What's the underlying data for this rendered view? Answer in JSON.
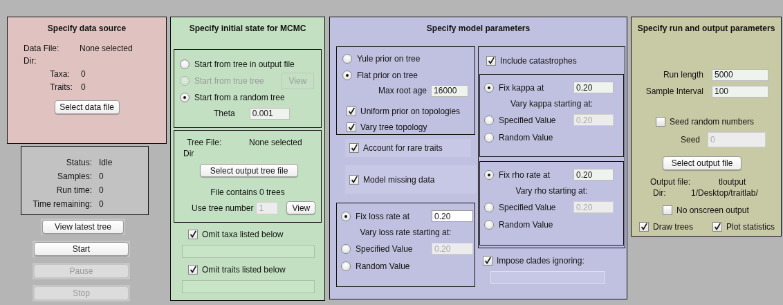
{
  "data_source": {
    "title": "Specify data source",
    "file_label": "Data File:",
    "file_value": "None selected",
    "dir_label": "Dir:",
    "counts": [
      {
        "label": "Taxa:",
        "value": "0"
      },
      {
        "label": "Traits:",
        "value": "0"
      }
    ],
    "button": "Select data file"
  },
  "status": [
    {
      "label": "Status:",
      "value": "Idle"
    },
    {
      "label": "Samples:",
      "value": "0"
    },
    {
      "label": "Run time:",
      "value": "0"
    },
    {
      "label": "Time remaining:",
      "value": "0"
    }
  ],
  "run_buttons": [
    {
      "label": "View latest tree",
      "disabled": false
    },
    {
      "label": "Start",
      "disabled": false
    },
    {
      "label": "Pause",
      "disabled": true
    },
    {
      "label": "Stop",
      "disabled": true
    }
  ],
  "initial_state": {
    "title": "Specify initial state for MCMC",
    "start_options": [
      {
        "label": "Start from tree in output file",
        "selected": false,
        "disabled": false
      },
      {
        "label": "Start from true tree",
        "selected": false,
        "disabled": true
      },
      {
        "label": "Start from a random tree",
        "selected": true,
        "disabled": false
      }
    ],
    "view_button": {
      "label": "View",
      "disabled": true
    },
    "theta": {
      "label": "Theta",
      "value": "0.001"
    },
    "tree_file": {
      "label": "Tree File:",
      "value": "None selected",
      "dir_label": "Dir",
      "button": "Select output tree file",
      "count_text": "File contains 0 trees",
      "number_label": "Use tree number",
      "number_value": "1",
      "number_disabled": true,
      "view_button": "View"
    },
    "omit": [
      {
        "label": "Omit taxa listed below",
        "checked": true
      },
      {
        "label": "Omit traits listed below",
        "checked": true
      }
    ]
  },
  "model": {
    "title": "Specify model parameters",
    "priors": [
      {
        "label": "Yule prior on tree",
        "selected": false
      },
      {
        "label": "Flat prior on tree",
        "selected": true
      }
    ],
    "max_root_age": {
      "label": "Max root age",
      "value": "16000"
    },
    "topology": [
      {
        "label": "Uniform prior on topologies",
        "checked": true
      },
      {
        "label": "Vary tree topology",
        "checked": true
      }
    ],
    "rare_traits": {
      "label": "Account for rare traits",
      "checked": true
    },
    "missing_data": {
      "label": "Model missing data",
      "checked": true
    },
    "loss_rate": {
      "vary_label": "Vary loss rate starting at:",
      "options": [
        {
          "label": "Fix loss rate at",
          "selected": true,
          "value": "0.20",
          "disabled": false
        },
        {
          "label": "Specified Value",
          "selected": false,
          "value": "0.20",
          "disabled": true
        },
        {
          "label": "Random Value",
          "selected": false
        }
      ]
    },
    "catastrophes": {
      "label": "Include catastrophes",
      "checked": true
    },
    "kappa": {
      "vary_label": "Vary kappa starting at:",
      "options": [
        {
          "label": "Fix kappa at",
          "selected": true,
          "value": "0.20",
          "disabled": false
        },
        {
          "label": "Specified Value",
          "selected": false,
          "value": "0.20",
          "disabled": true
        },
        {
          "label": "Random Value",
          "selected": false
        }
      ]
    },
    "rho": {
      "vary_label": "Vary rho starting at:",
      "options": [
        {
          "label": "Fix rho rate at",
          "selected": true,
          "value": "0.20",
          "disabled": false
        },
        {
          "label": "Specified Value",
          "selected": false,
          "value": "0.20",
          "disabled": true
        },
        {
          "label": "Random Value",
          "selected": false
        }
      ]
    },
    "impose_clades": {
      "label": "Impose clades ignoring:",
      "checked": true
    }
  },
  "run_output": {
    "title": "Specify run and output parameters",
    "fields": [
      {
        "label": "Run length",
        "value": "5000"
      },
      {
        "label": "Sample Interval",
        "value": "100"
      }
    ],
    "seed_random": {
      "label": "Seed random numbers",
      "checked": false
    },
    "seed": {
      "label": "Seed",
      "value": "0",
      "disabled": true
    },
    "button": "Select output file",
    "output_file": {
      "label": "Output file:",
      "value": "tloutput"
    },
    "dir": {
      "label": "Dir:",
      "value": "1/Desktop/traitlab/"
    },
    "no_onscreen": {
      "label": "No onscreen output",
      "checked": false
    },
    "draw_options": [
      {
        "label": "Draw trees",
        "checked": true
      },
      {
        "label": "Plot statistics",
        "checked": true
      }
    ]
  }
}
